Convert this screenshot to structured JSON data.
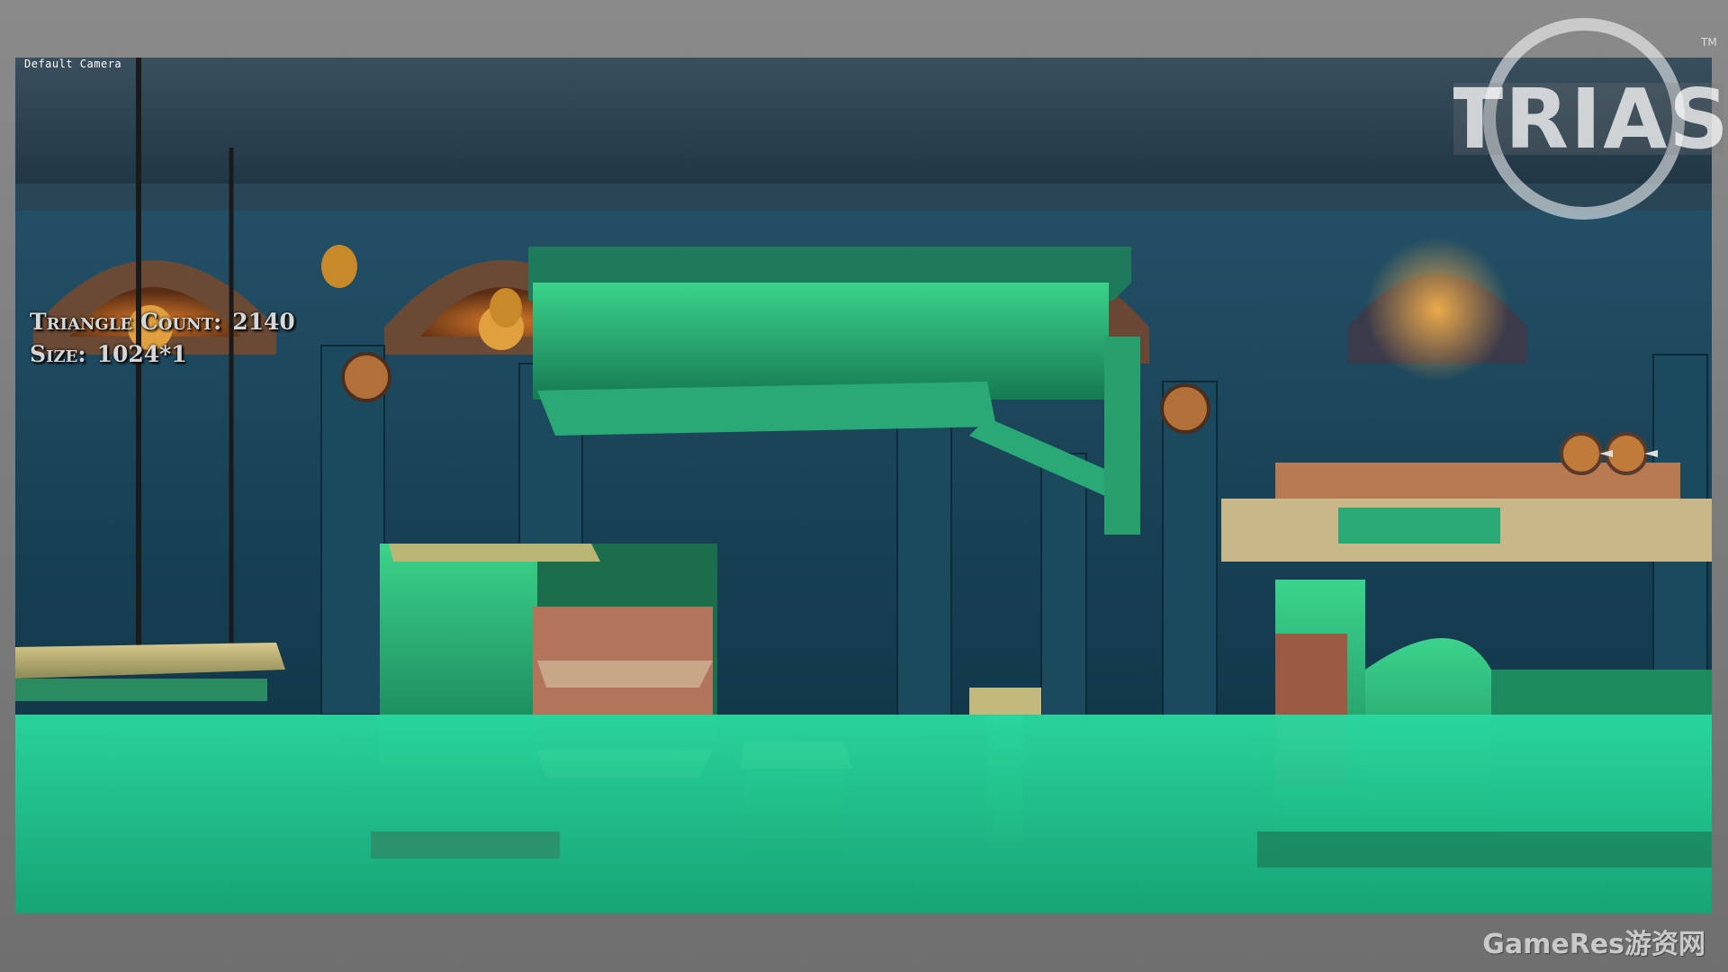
{
  "window": {
    "camera_label": "Default Camera"
  },
  "overlay": {
    "triangle_count_label": "Triangle Count:",
    "triangle_count_value": "2140",
    "size_label": "Size:",
    "size_value": "1024*1"
  },
  "branding": {
    "logo_text": "TRIAS",
    "trademark": "TM",
    "watermark": "GameRes游资网"
  },
  "colors": {
    "water": "#1fc890",
    "stone_green": "#2fa06a",
    "stone_blue": "#1c4a5c",
    "torch": "#e89a3a",
    "frame": "#7b7b7b"
  }
}
